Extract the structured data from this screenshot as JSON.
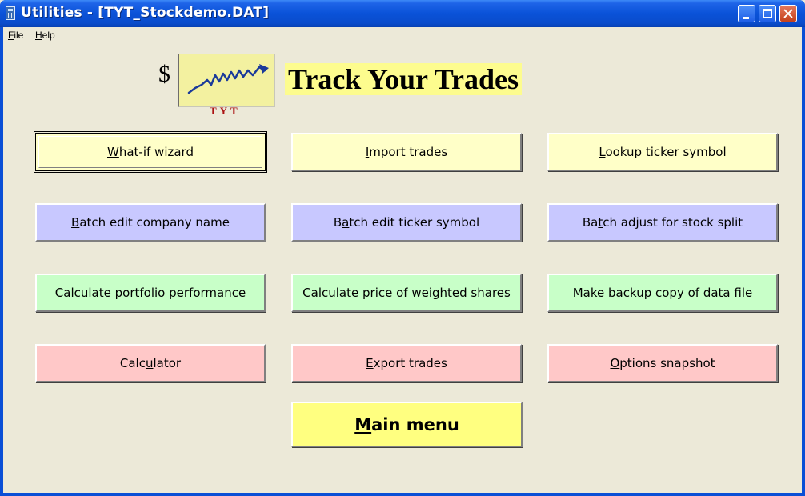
{
  "window": {
    "title": "Utilities - [TYT_Stockdemo.DAT]"
  },
  "menu": {
    "items": [
      {
        "label": "File"
      },
      {
        "label": "Help"
      }
    ]
  },
  "logo": {
    "symbol": "$",
    "caption": "TYT",
    "line_color": "#1a3a9a",
    "box_color": "#f3f1a0"
  },
  "brand": {
    "title": "Track Your Trades",
    "highlight_color": "#fdfc8e"
  },
  "buttons": [
    {
      "pre": "",
      "key": "W",
      "post": "hat-if wizard",
      "color": "#ffffc8",
      "focused": true
    },
    {
      "pre": "",
      "key": "I",
      "post": "mport trades",
      "color": "#ffffc8"
    },
    {
      "pre": "",
      "key": "L",
      "post": "ookup ticker symbol",
      "color": "#ffffc8"
    },
    {
      "pre": "",
      "key": "B",
      "post": "atch edit company name",
      "color": "#c8c8ff"
    },
    {
      "pre": "B",
      "key": "a",
      "post": "tch edit ticker symbol",
      "color": "#c8c8ff"
    },
    {
      "pre": "Ba",
      "key": "t",
      "post": "ch adjust for stock split",
      "color": "#c8c8ff"
    },
    {
      "pre": "",
      "key": "C",
      "post": "alculate portfolio performance",
      "color": "#c8ffc8"
    },
    {
      "pre": "Calculate ",
      "key": "p",
      "post": "rice of weighted shares",
      "color": "#c8ffc8"
    },
    {
      "pre": "Make backup copy of ",
      "key": "d",
      "post": "ata file",
      "color": "#c8ffc8"
    },
    {
      "pre": "Calc",
      "key": "u",
      "post": "lator",
      "color": "#ffc8c8"
    },
    {
      "pre": "",
      "key": "E",
      "post": "xport trades",
      "color": "#ffc8c8"
    },
    {
      "pre": "",
      "key": "O",
      "post": "ptions snapshot",
      "color": "#ffc8c8"
    }
  ],
  "main_button": {
    "pre": "",
    "key": "M",
    "post": "ain menu",
    "color": "#ffff80"
  }
}
